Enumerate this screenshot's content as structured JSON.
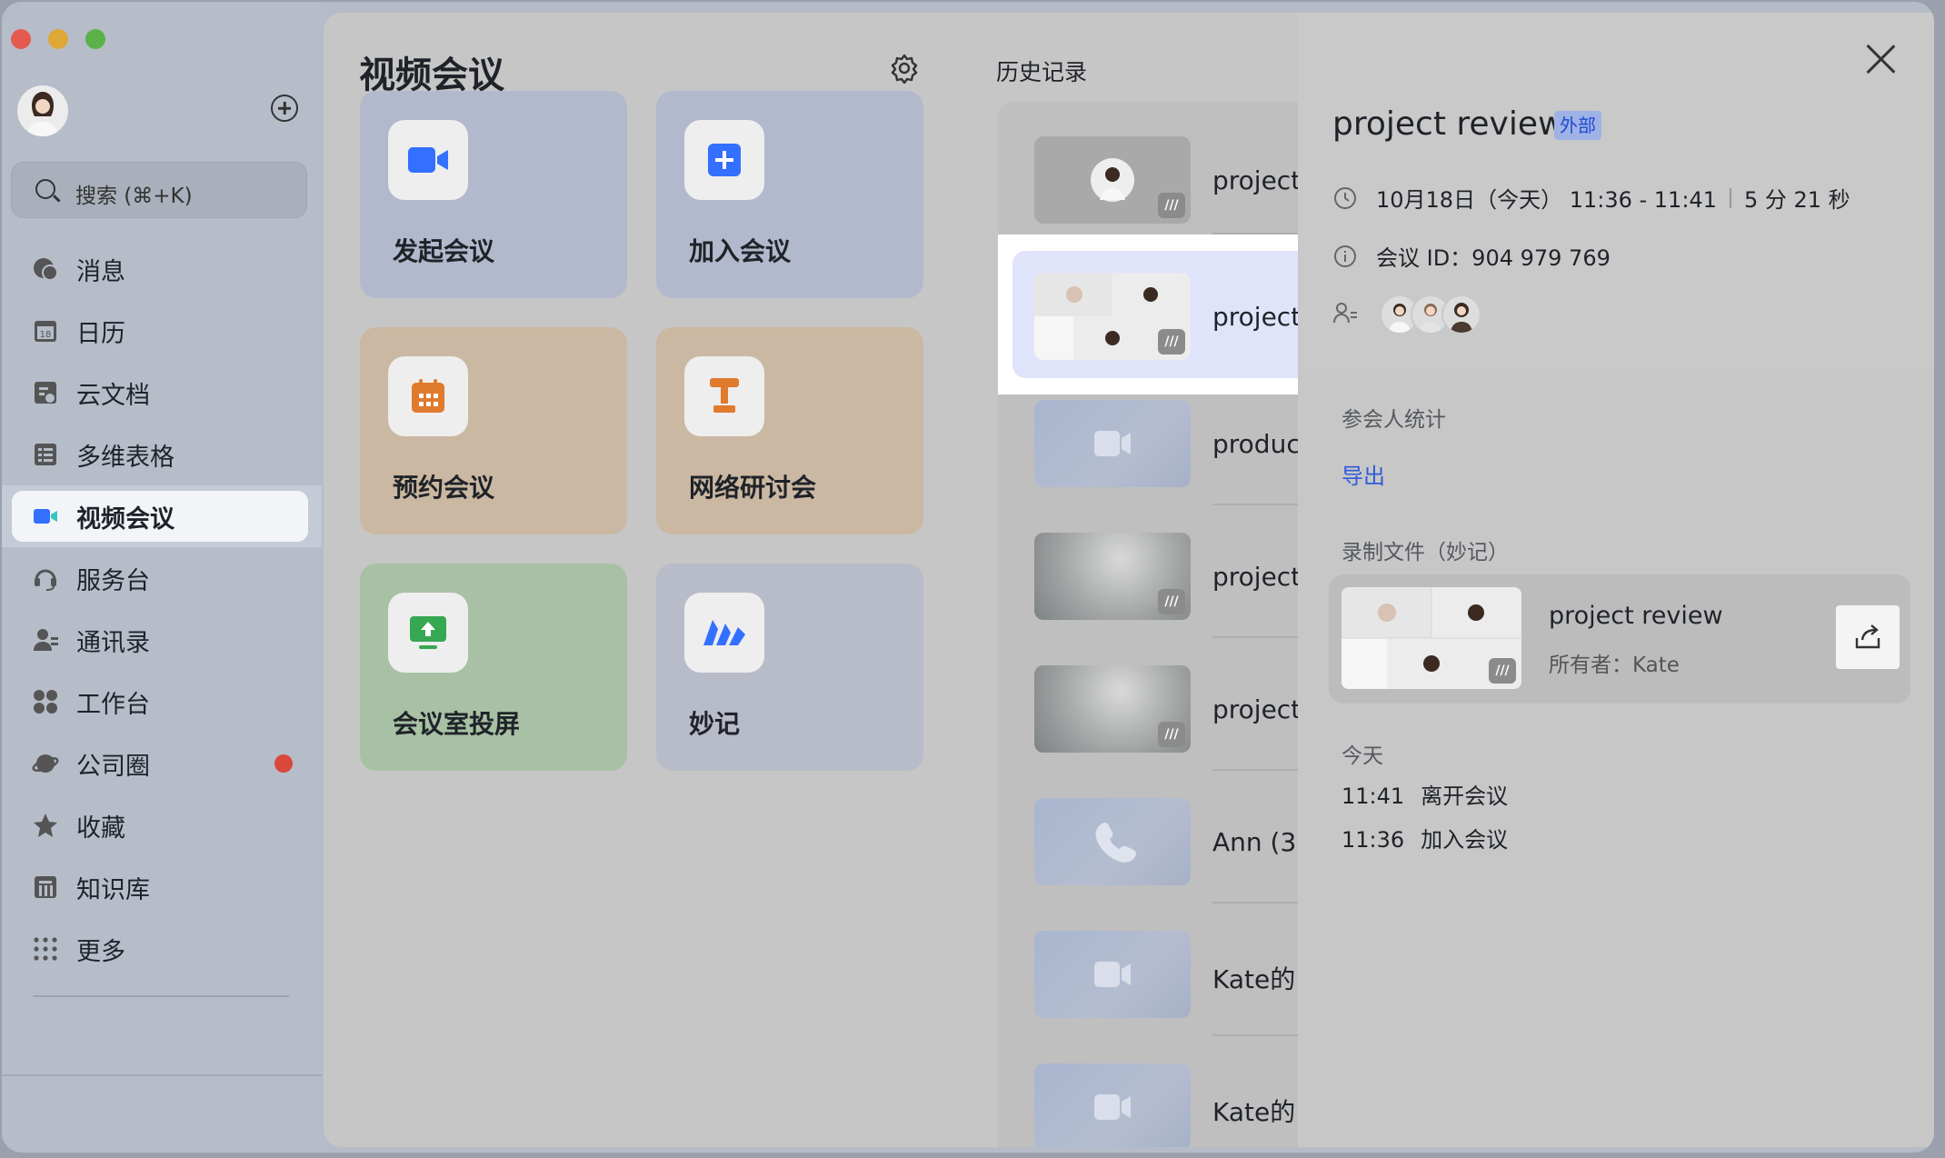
{
  "sidebar": {
    "search_placeholder": "搜索 (⌘+K)",
    "items": [
      {
        "label": "消息",
        "icon": "message-icon"
      },
      {
        "label": "日历",
        "icon": "calendar-icon",
        "icon_text": "18"
      },
      {
        "label": "云文档",
        "icon": "docs-icon"
      },
      {
        "label": "多维表格",
        "icon": "base-icon"
      },
      {
        "label": "视频会议",
        "icon": "video-meeting-icon",
        "active": true
      },
      {
        "label": "服务台",
        "icon": "helpdesk-icon"
      },
      {
        "label": "通讯录",
        "icon": "contacts-icon"
      },
      {
        "label": "工作台",
        "icon": "workplace-icon"
      },
      {
        "label": "公司圈",
        "icon": "moments-icon",
        "has_dot": true
      },
      {
        "label": "收藏",
        "icon": "favorites-icon"
      },
      {
        "label": "知识库",
        "icon": "wiki-icon"
      },
      {
        "label": "更多",
        "icon": "more-icon"
      }
    ],
    "accent_color": "#3370ff",
    "dot_color": "#d9483b"
  },
  "main": {
    "title": "视频会议",
    "tiles": [
      {
        "label": "发起会议",
        "icon": "start-meeting-icon"
      },
      {
        "label": "加入会议",
        "icon": "join-meeting-icon"
      },
      {
        "label": "预约会议",
        "icon": "schedule-meeting-icon"
      },
      {
        "label": "网络研讨会",
        "icon": "webinar-icon"
      },
      {
        "label": "会议室投屏",
        "icon": "share-screen-icon"
      },
      {
        "label": "妙记",
        "icon": "minutes-icon"
      }
    ]
  },
  "history": {
    "title": "历史记录",
    "items": [
      {
        "title": "project"
      },
      {
        "title": "project",
        "selected": true
      },
      {
        "title": "produc"
      },
      {
        "title": "project"
      },
      {
        "title": "project"
      },
      {
        "title": "Ann (3"
      },
      {
        "title": "Kate的"
      },
      {
        "title": "Kate的"
      }
    ]
  },
  "detail": {
    "title": "project review",
    "badge": "外部",
    "time": "10月18日（今天） 11:36 - 11:41",
    "duration": "5 分 21 秒",
    "meeting_id": "会议 ID：904 979 769",
    "section_stats": "参会人统计",
    "export_link": "导出",
    "section_recording": "录制文件（妙记）",
    "recording": {
      "name": "project review",
      "owner": "所有者：Kate"
    },
    "section_today": "今天",
    "log": [
      {
        "time": "11:41",
        "event": "离开会议"
      },
      {
        "time": "11:36",
        "event": "加入会议"
      }
    ]
  }
}
